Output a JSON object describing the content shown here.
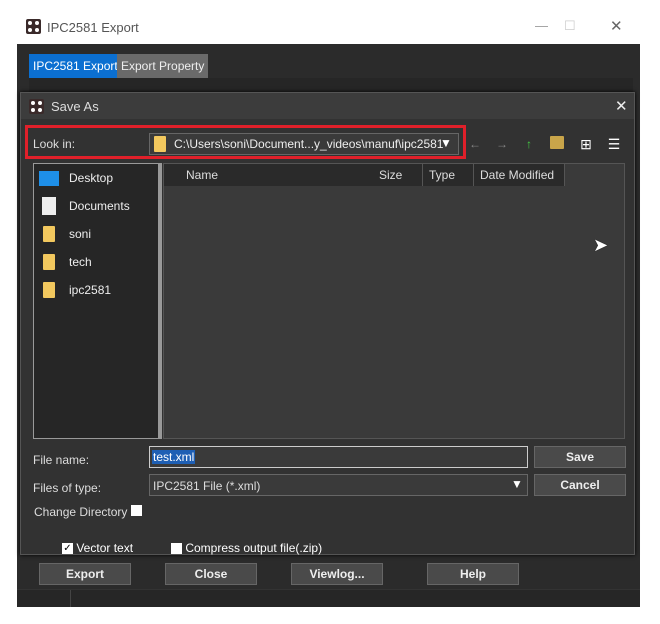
{
  "window": {
    "title": "IPC2581 Export",
    "minimize": "—",
    "maximize": "☐",
    "close": "✕"
  },
  "tabs": [
    {
      "label": "IPC2581 Export",
      "active": true
    },
    {
      "label": "Export Property",
      "active": false
    }
  ],
  "dialog": {
    "title": "Save As",
    "close": "✕",
    "look_in_label": "Look in:",
    "look_in_value": "C:\\Users\\soni\\Document...y_videos\\manuf\\ipc2581",
    "toolbar": [
      "back-icon",
      "forward-icon",
      "up-folder-icon",
      "new-folder-icon",
      "icon-view-icon",
      "list-view-icon"
    ],
    "sidebar": [
      {
        "label": "Desktop",
        "icon": "desktop-icon"
      },
      {
        "label": "Documents",
        "icon": "documents-icon"
      },
      {
        "label": "soni",
        "icon": "user-folder-icon"
      },
      {
        "label": "tech",
        "icon": "folder-icon"
      },
      {
        "label": "ipc2581",
        "icon": "folder-icon"
      }
    ],
    "columns": [
      "Name",
      "Size",
      "Type",
      "Date Modified"
    ],
    "file_name_label": "File name:",
    "file_name_value": "test.xml",
    "files_of_type_label": "Files of type:",
    "files_of_type_value": "IPC2581 File (*.xml)",
    "save": "Save",
    "cancel": "Cancel",
    "change_directory": "Change Directory",
    "change_directory_checked": false
  },
  "options": {
    "vector_text": "Vector text",
    "vector_text_checked": true,
    "compress": "Compress output file(.zip)",
    "compress_checked": false
  },
  "buttons": {
    "export": "Export",
    "close": "Close",
    "viewlog": "Viewlog...",
    "help": "Help"
  },
  "colors": {
    "highlight": "#e0202a",
    "active_tab": "#0b6fd1",
    "selection": "#1e5fb4"
  }
}
